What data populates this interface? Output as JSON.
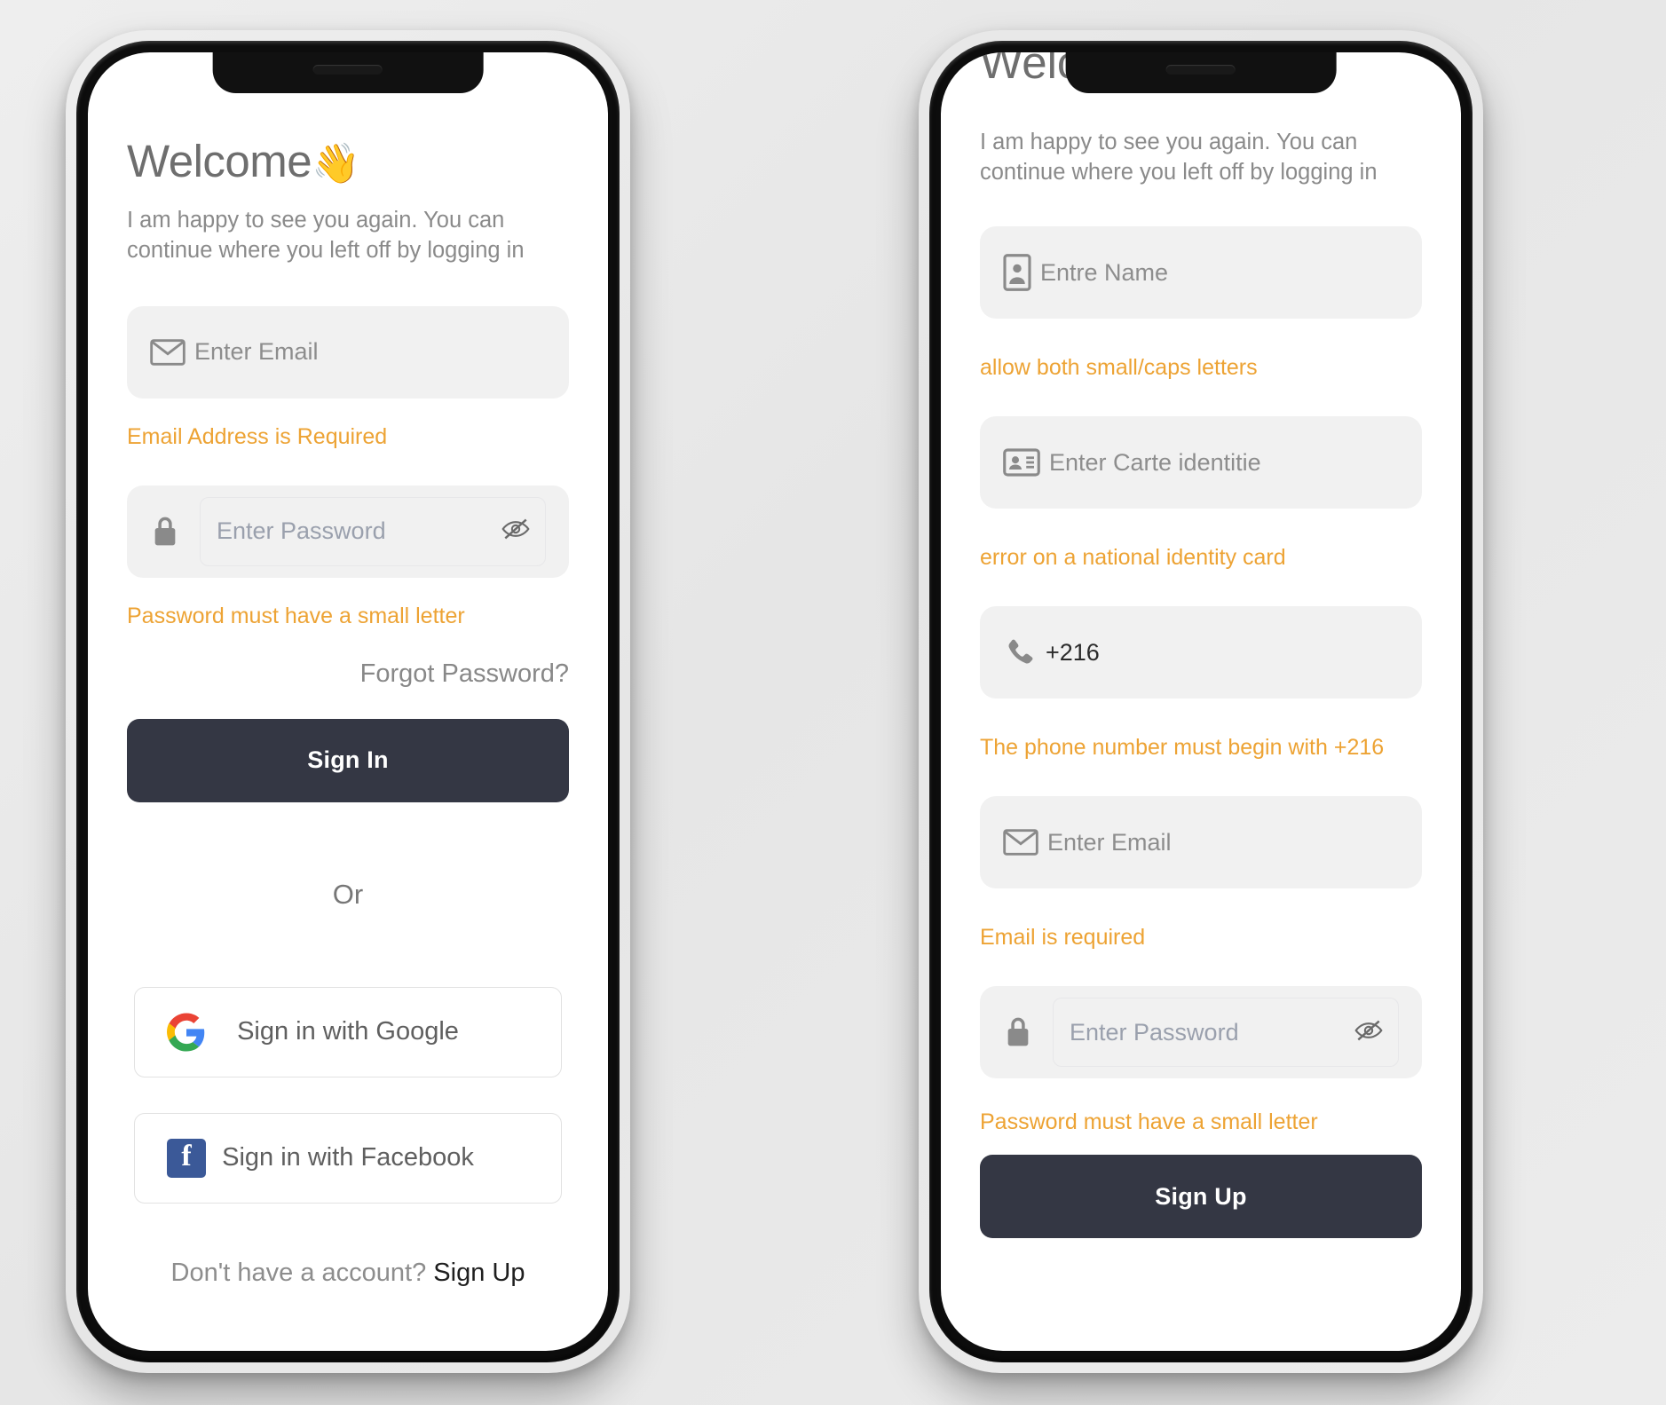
{
  "theme": {
    "background": "#e9e9e9",
    "accent_orange": "#eda334",
    "primary_button": "#343744",
    "field_background": "#f1f1f1",
    "facebook_blue": "#3b5998"
  },
  "signin_screen": {
    "title": "Welcome",
    "title_emoji": "👋",
    "subtitle": "I am happy to see you again. You can continue where you left off by logging in",
    "email_field": {
      "icon": "envelope-icon",
      "placeholder": "Enter Email",
      "value": "",
      "error": "Email Address is Required"
    },
    "password_field": {
      "icon": "lock-icon",
      "placeholder": "Enter Password",
      "value": "",
      "toggle_icon": "eye-off-icon",
      "error": "Password must have a small letter"
    },
    "forgot_password": "Forgot Password?",
    "submit_label": "Sign In",
    "divider_label": "Or",
    "social_buttons": [
      {
        "icon": "google-icon",
        "label": "Sign in with Google"
      },
      {
        "icon": "facebook-icon",
        "label": "Sign in with Facebook",
        "glyph": "f"
      }
    ],
    "footer": {
      "prompt": "Don't have a account?",
      "link": "Sign Up"
    }
  },
  "signup_screen": {
    "title_clipped": "Welcome",
    "subtitle": "I am happy to see you again. You can continue where you left off by logging in",
    "name_field": {
      "icon": "contact-card-icon",
      "placeholder": "Entre Name",
      "value": "",
      "error": "allow both small/caps letters"
    },
    "identity_field": {
      "icon": "id-card-icon",
      "placeholder": "Enter Carte identitie",
      "value": "",
      "error": "error on a national identity card"
    },
    "phone_field": {
      "icon": "phone-icon",
      "placeholder": "",
      "value": "+216",
      "error": "The phone number must begin with +216"
    },
    "email_field": {
      "icon": "envelope-icon",
      "placeholder": "Enter Email",
      "value": "",
      "error": "Email is required"
    },
    "password_field": {
      "icon": "lock-icon",
      "placeholder": "Enter Password",
      "value": "",
      "toggle_icon": "eye-off-icon",
      "error": "Password must have a small letter"
    },
    "submit_label": "Sign Up"
  }
}
